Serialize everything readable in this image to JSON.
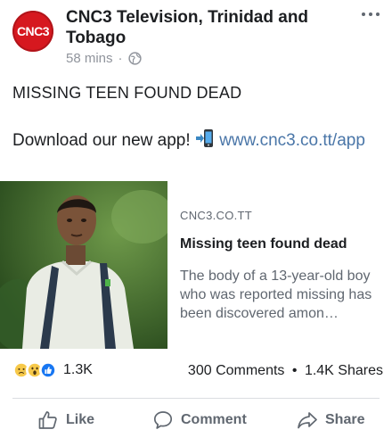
{
  "header": {
    "avatar_text": "CNC3",
    "page_name": "CNC3 Television, Trinidad and Tobago",
    "time": "58 mins",
    "separator": "·",
    "privacy_icon": "globe-icon",
    "more_icon": "more-options-icon"
  },
  "post": {
    "headline": "MISSING TEEN FOUND DEAD",
    "promo_text": "Download our new app!",
    "promo_emoji": "mobile-phone-arrow-icon",
    "promo_link": "www.cnc3.co.tt/app"
  },
  "link_card": {
    "domain": "CNC3.CO.TT",
    "title": "Missing teen found dead",
    "description": "The body of a 13-year-old boy who was reported missing has been discovered amon…"
  },
  "reactions": {
    "icons": [
      "sad-reaction-icon",
      "wow-reaction-icon",
      "like-reaction-icon"
    ],
    "count": "1.3K",
    "comments": "300 Comments",
    "dot": "•",
    "shares": "1.4K Shares"
  },
  "actions": {
    "like": "Like",
    "comment": "Comment",
    "share": "Share"
  },
  "colors": {
    "brand_red": "#d6181f",
    "link_blue": "#4a76a8",
    "like_blue": "#1877f2",
    "emoji_yellow": "#f7c94a",
    "secondary_text": "#606770"
  }
}
